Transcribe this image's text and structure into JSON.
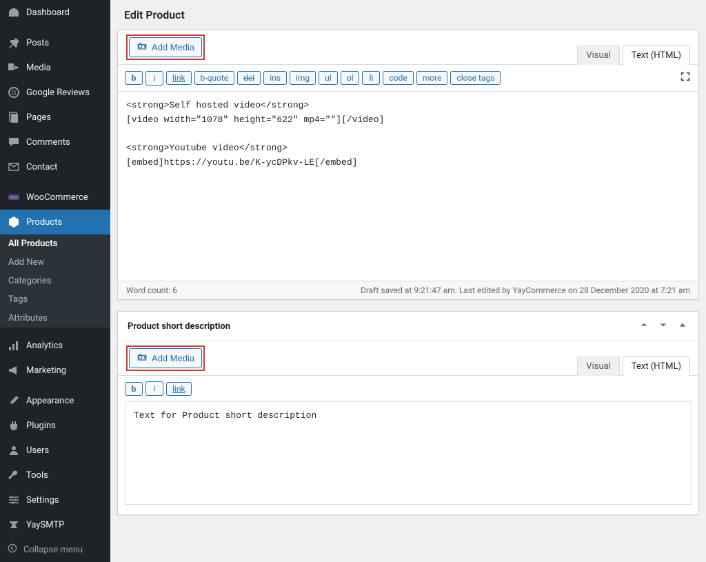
{
  "page": {
    "title": "Edit Product"
  },
  "sidebar": {
    "items": [
      {
        "label": "Dashboard",
        "icon": "gauge"
      },
      {
        "label": "Posts",
        "icon": "pin"
      },
      {
        "label": "Media",
        "icon": "media"
      },
      {
        "label": "Google Reviews",
        "icon": "g"
      },
      {
        "label": "Pages",
        "icon": "pages"
      },
      {
        "label": "Comments",
        "icon": "comment"
      },
      {
        "label": "Contact",
        "icon": "mail"
      },
      {
        "label": "WooCommerce",
        "icon": "woo"
      },
      {
        "label": "Products",
        "icon": "box"
      },
      {
        "label": "Analytics",
        "icon": "bars"
      },
      {
        "label": "Marketing",
        "icon": "megaphone"
      },
      {
        "label": "Appearance",
        "icon": "brush"
      },
      {
        "label": "Plugins",
        "icon": "plug"
      },
      {
        "label": "Users",
        "icon": "user"
      },
      {
        "label": "Tools",
        "icon": "wrench"
      },
      {
        "label": "Settings",
        "icon": "sliders"
      },
      {
        "label": "YaySMTP",
        "icon": "yay"
      }
    ],
    "submenu": {
      "items": [
        "All Products",
        "Add New",
        "Categories",
        "Tags",
        "Attributes"
      ],
      "active": 0
    },
    "collapse": "Collapse menu"
  },
  "editor1": {
    "add_media": "Add Media",
    "tabs": {
      "visual": "Visual",
      "text": "Text (HTML)"
    },
    "toolbar": [
      "b",
      "i",
      "link",
      "b-quote",
      "del",
      "ins",
      "img",
      "ul",
      "ol",
      "li",
      "code",
      "more",
      "close tags"
    ],
    "content": "<strong>Self hosted video</strong>\n[video width=\"1078\" height=\"622\" mp4=\"\"][/video]\n\n<strong>Youtube video</strong>\n[embed]https://youtu.be/K-ycDPkv-LE[/embed]",
    "word_count_label": "Word count: 6",
    "status": "Draft saved at 9:21:47 am. Last edited by YayCommerce on 28 December 2020 at 7:21 am"
  },
  "editor2": {
    "title": "Product short description",
    "add_media": "Add Media",
    "tabs": {
      "visual": "Visual",
      "text": "Text (HTML)"
    },
    "toolbar": [
      "b",
      "i",
      "link"
    ],
    "content": "Text for Product short description"
  }
}
